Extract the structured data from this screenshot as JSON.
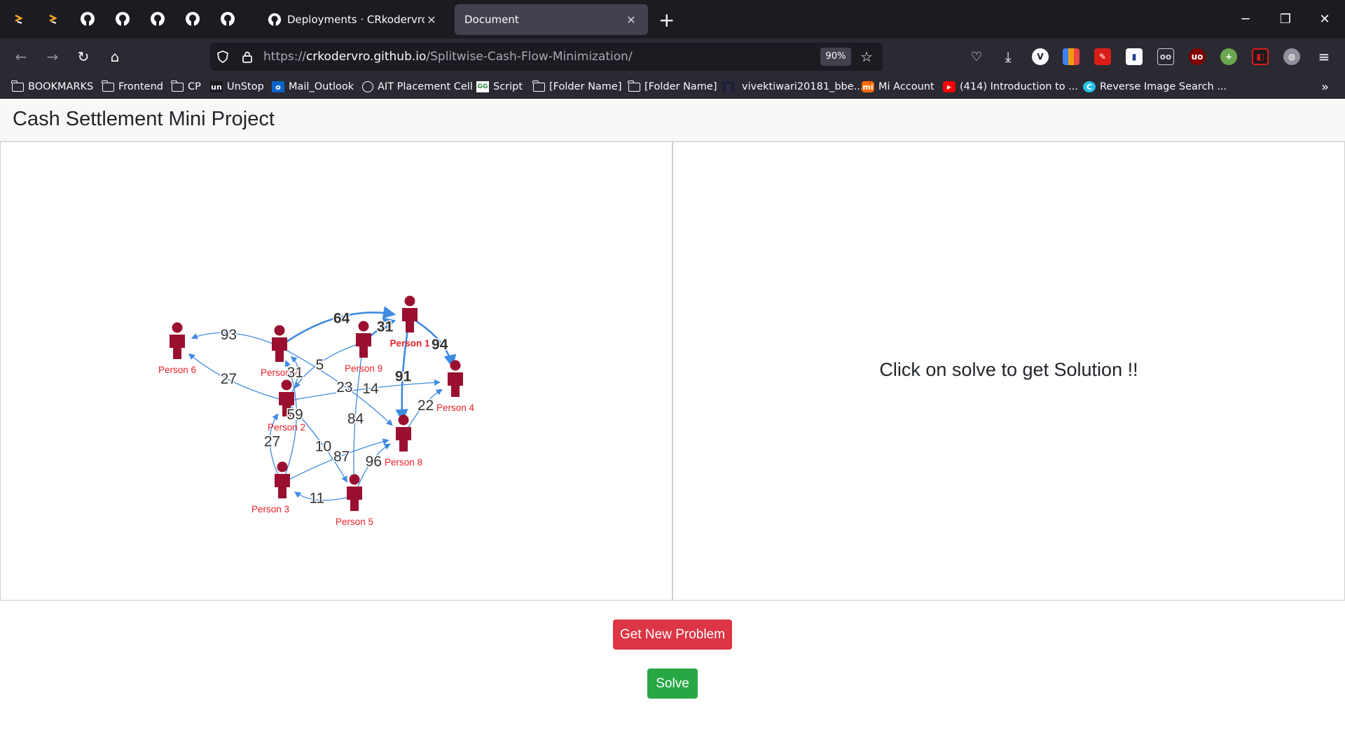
{
  "browser": {
    "tabs": [
      {
        "title": "Deployments · CRkodervro/Splitwise",
        "active": false
      },
      {
        "title": "Document",
        "active": true
      }
    ],
    "url": {
      "scheme": "https://",
      "host": "crkodervro.github.io",
      "path": "/Splitwise-Cash-Flow-Minimization/"
    },
    "zoom": "90%",
    "bookmarks": [
      {
        "label": "BOOKMARKS",
        "icon": "folder-icon"
      },
      {
        "label": "Frontend",
        "icon": "folder-icon"
      },
      {
        "label": "CP",
        "icon": "folder-icon"
      },
      {
        "label": "UnStop",
        "icon": "unstop-icon"
      },
      {
        "label": "Mail_Outlook",
        "icon": "outlook-icon"
      },
      {
        "label": "AIT Placement Cell",
        "icon": "globe-icon"
      },
      {
        "label": "Script",
        "icon": "gfg-icon"
      },
      {
        "label": "[Folder Name]",
        "icon": "folder-icon"
      },
      {
        "label": "[Folder Name]",
        "icon": "folder-icon"
      },
      {
        "label": "vivektiwari20181_bbe...",
        "icon": "page-icon"
      },
      {
        "label": "Mi Account",
        "icon": "mi-icon"
      },
      {
        "label": "(414) Introduction to ...",
        "icon": "youtube-icon"
      },
      {
        "label": "Reverse Image Search ...",
        "icon": "reverse-search-icon"
      }
    ]
  },
  "page": {
    "title": "Cash Settlement Mini Project",
    "solution_placeholder": "Click on solve to get Solution !!",
    "new_problem_label": "Get New Problem",
    "solve_label": "Solve"
  },
  "graph": {
    "node_color": "#9b1030",
    "label_color": "#e8202a",
    "edge_color": "#3f8be0",
    "nodes": [
      {
        "id": "p1",
        "label": "Person 1",
        "bold": true
      },
      {
        "id": "p2",
        "label": "Person 2"
      },
      {
        "id": "p3",
        "label": "Person 3"
      },
      {
        "id": "p4",
        "label": "Person 4"
      },
      {
        "id": "p5",
        "label": "Person 5"
      },
      {
        "id": "p6",
        "label": "Person 6"
      },
      {
        "id": "p7",
        "label": "Person 7"
      },
      {
        "id": "p8",
        "label": "Person 8"
      },
      {
        "id": "p9",
        "label": "Person 9"
      }
    ],
    "edges": [
      {
        "from": "p7",
        "to": "p1",
        "amount": "64",
        "bold": true
      },
      {
        "from": "p9",
        "to": "p1",
        "amount": "31",
        "bold": true
      },
      {
        "from": "p1",
        "to": "p4",
        "amount": "94",
        "bold": true
      },
      {
        "from": "p1",
        "to": "p8",
        "amount": "91",
        "bold": true
      },
      {
        "from": "p7",
        "to": "p6",
        "amount": "93"
      },
      {
        "from": "p2",
        "to": "p6",
        "amount": "27"
      },
      {
        "from": "p2",
        "to": "p7",
        "amount": "31"
      },
      {
        "from": "p9",
        "to": "p2",
        "amount": "5"
      },
      {
        "from": "p7",
        "to": "p8",
        "amount": "23"
      },
      {
        "from": "p2",
        "to": "p4",
        "amount": "14"
      },
      {
        "from": "p9",
        "to": "p5",
        "amount": "84"
      },
      {
        "from": "p3",
        "to": "p7",
        "amount": "59"
      },
      {
        "from": "p3",
        "to": "p2",
        "amount": "27"
      },
      {
        "from": "p2",
        "to": "p5",
        "amount": "10"
      },
      {
        "from": "p3",
        "to": "p8",
        "amount": "87"
      },
      {
        "from": "p5",
        "to": "p8",
        "amount": "96"
      },
      {
        "from": "p5",
        "to": "p3",
        "amount": "11"
      },
      {
        "from": "p8",
        "to": "p4",
        "amount": "22"
      }
    ]
  }
}
